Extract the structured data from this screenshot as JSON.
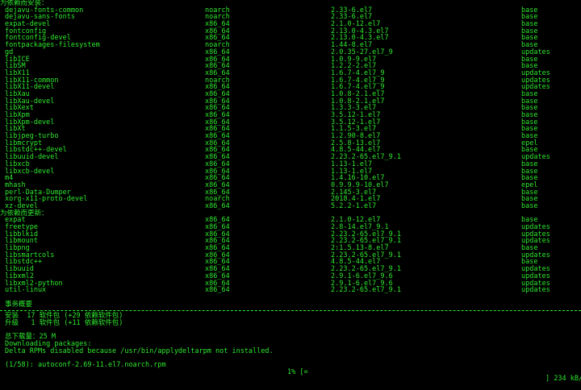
{
  "sections": [
    {
      "title": "为依赖而安装：",
      "rows": [
        {
          "name": "dejavu-fonts-common",
          "arch": "noarch",
          "version": "2.33-6.el7",
          "repo": "base"
        },
        {
          "name": "dejavu-sans-fonts",
          "arch": "noarch",
          "version": "2.33-6.el7",
          "repo": "base"
        },
        {
          "name": "expat-devel",
          "arch": "x86_64",
          "version": "2.1.0-12.el7",
          "repo": "base"
        },
        {
          "name": "fontconfig",
          "arch": "x86_64",
          "version": "2.13.0-4.3.el7",
          "repo": "base"
        },
        {
          "name": "fontconfig-devel",
          "arch": "x86_64",
          "version": "2.13.0-4.3.el7",
          "repo": "base"
        },
        {
          "name": "fontpackages-filesystem",
          "arch": "noarch",
          "version": "1.44-8.el7",
          "repo": "base"
        },
        {
          "name": "gd",
          "arch": "x86_64",
          "version": "2.0.35-27.el7_9",
          "repo": "updates"
        },
        {
          "name": "libICE",
          "arch": "x86_64",
          "version": "1.0.9-9.el7",
          "repo": "base"
        },
        {
          "name": "libSM",
          "arch": "x86_64",
          "version": "1.2.2-2.el7",
          "repo": "base"
        },
        {
          "name": "libX11",
          "arch": "x86_64",
          "version": "1.6.7-4.el7_9",
          "repo": "updates"
        },
        {
          "name": "libX11-common",
          "arch": "noarch",
          "version": "1.6.7-4.el7_9",
          "repo": "updates"
        },
        {
          "name": "libX11-devel",
          "arch": "x86_64",
          "version": "1.6.7-4.el7_9",
          "repo": "updates"
        },
        {
          "name": "libXau",
          "arch": "x86_64",
          "version": "1.0.8-2.1.el7",
          "repo": "base"
        },
        {
          "name": "libXau-devel",
          "arch": "x86_64",
          "version": "1.0.8-2.1.el7",
          "repo": "base"
        },
        {
          "name": "libXext",
          "arch": "x86_64",
          "version": "1.3.3-3.el7",
          "repo": "base"
        },
        {
          "name": "libXpm",
          "arch": "x86_64",
          "version": "3.5.12-1.el7",
          "repo": "base"
        },
        {
          "name": "libXpm-devel",
          "arch": "x86_64",
          "version": "3.5.12-1.el7",
          "repo": "base"
        },
        {
          "name": "libXt",
          "arch": "x86_64",
          "version": "1.1.5-3.el7",
          "repo": "base"
        },
        {
          "name": "libjpeg-turbo",
          "arch": "x86_64",
          "version": "1.2.90-8.el7",
          "repo": "base"
        },
        {
          "name": "libmcrypt",
          "arch": "x86_64",
          "version": "2.5.8-13.el7",
          "repo": "epel"
        },
        {
          "name": "libstdc++-devel",
          "arch": "x86_64",
          "version": "4.8.5-44.el7",
          "repo": "base"
        },
        {
          "name": "libuuid-devel",
          "arch": "x86_64",
          "version": "2.23.2-65.el7_9.1",
          "repo": "updates"
        },
        {
          "name": "libxcb",
          "arch": "x86_64",
          "version": "1.13-1.el7",
          "repo": "base"
        },
        {
          "name": "libxcb-devel",
          "arch": "x86_64",
          "version": "1.13-1.el7",
          "repo": "base"
        },
        {
          "name": "m4",
          "arch": "x86_64",
          "version": "1.4.16-10.el7",
          "repo": "base"
        },
        {
          "name": "mhash",
          "arch": "x86_64",
          "version": "0.9.9.9-10.el7",
          "repo": "epel"
        },
        {
          "name": "perl-Data-Dumper",
          "arch": "x86_64",
          "version": "2.145-3.el7",
          "repo": "base"
        },
        {
          "name": "xorg-x11-proto-devel",
          "arch": "noarch",
          "version": "2018.4-1.el7",
          "repo": "base"
        },
        {
          "name": "xz-devel",
          "arch": "x86_64",
          "version": "5.2.2-1.el7",
          "repo": "base"
        }
      ]
    },
    {
      "title": "为依赖而更新：",
      "rows": [
        {
          "name": "expat",
          "arch": "x86_64",
          "version": "2.1.0-12.el7",
          "repo": "base"
        },
        {
          "name": "freetype",
          "arch": "x86_64",
          "version": "2.8-14.el7_9.1",
          "repo": "updates"
        },
        {
          "name": "libblkid",
          "arch": "x86_64",
          "version": "2.23.2-65.el7_9.1",
          "repo": "updates"
        },
        {
          "name": "libmount",
          "arch": "x86_64",
          "version": "2.23.2-65.el7_9.1",
          "repo": "updates"
        },
        {
          "name": "libpng",
          "arch": "x86_64",
          "version": "2:1.5.13-8.el7",
          "repo": "base"
        },
        {
          "name": "libsmartcols",
          "arch": "x86_64",
          "version": "2.23.2-65.el7_9.1",
          "repo": "updates"
        },
        {
          "name": "libstdc++",
          "arch": "x86_64",
          "version": "4.8.5-44.el7",
          "repo": "base"
        },
        {
          "name": "libuuid",
          "arch": "x86_64",
          "version": "2.23.2-65.el7_9.1",
          "repo": "updates"
        },
        {
          "name": "libxml2",
          "arch": "x86_64",
          "version": "2.9.1-6.el7_9.6",
          "repo": "updates"
        },
        {
          "name": "libxml2-python",
          "arch": "x86_64",
          "version": "2.9.1-6.el7_9.6",
          "repo": "updates"
        },
        {
          "name": "util-linux",
          "arch": "x86_64",
          "version": "2.23.2-65.el7_9.1",
          "repo": "updates"
        }
      ]
    }
  ],
  "summary": {
    "title": "事务概要",
    "install_line": "安装  17 软件包 (+29 依赖软件包)",
    "upgrade_line": "升级   1 软件包 (+11 依赖软件包)",
    "total_size": "总下载量：25 M",
    "downloading": "Downloading packages:",
    "delta_msg": "Delta RPMs disabled because /usr/bin/applydeltarpm not installed."
  },
  "progress": {
    "counter": "1/58",
    "file": ": autoconf-2.69-11.el7.noarch.rpm",
    "percent": "1% [=",
    "tail": "] 234 kB/s",
    "fraction": 0.01
  }
}
